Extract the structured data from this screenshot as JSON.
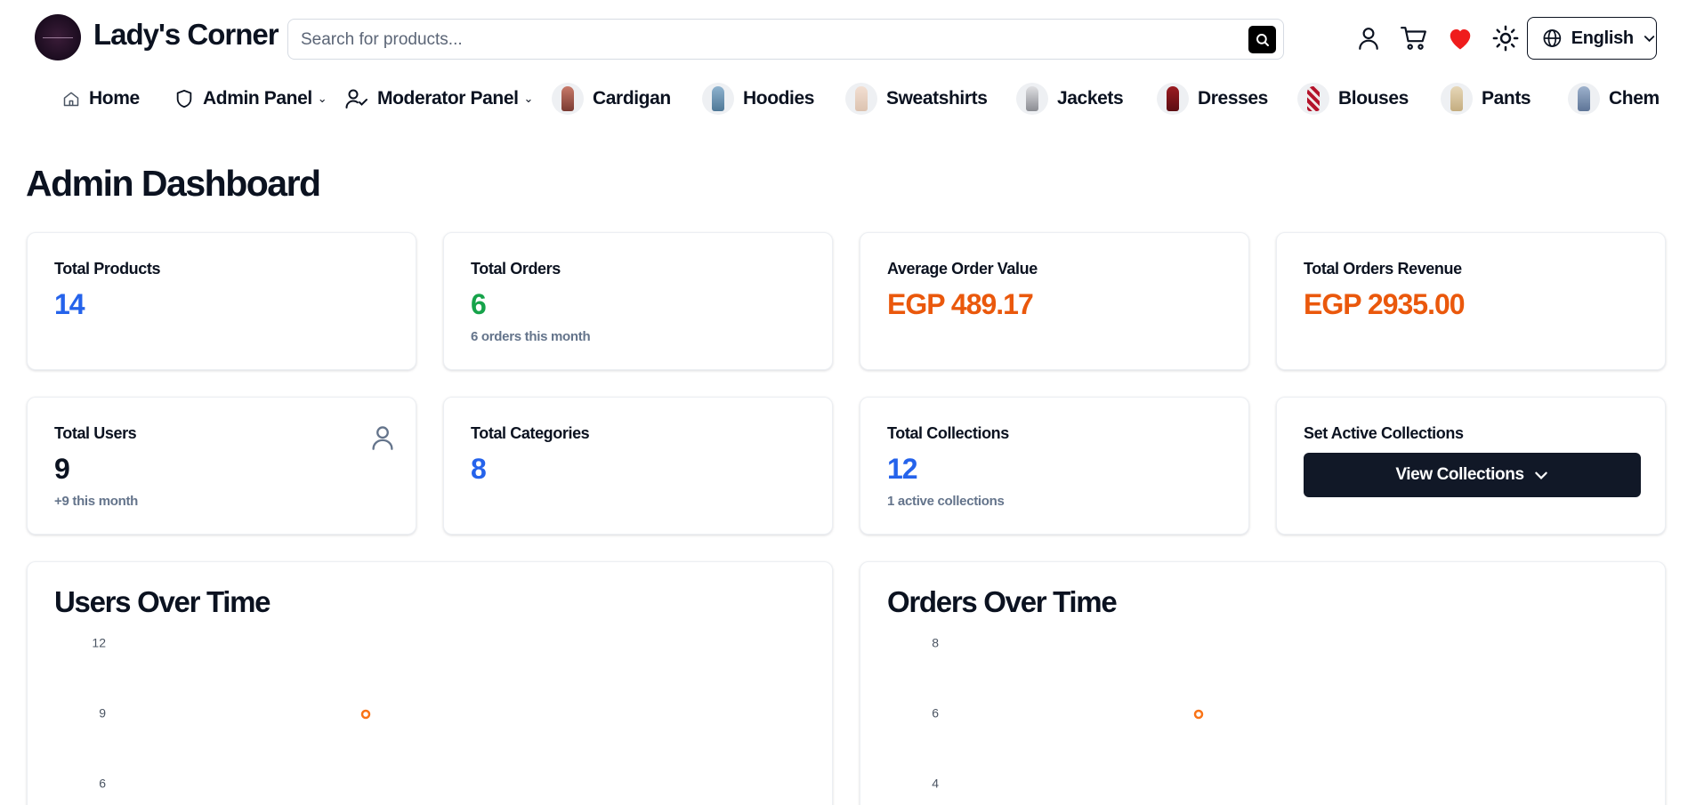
{
  "header": {
    "brand": "Lady's Corner",
    "search_placeholder": "Search for products...",
    "language": "English"
  },
  "nav": {
    "items": [
      {
        "label": "Home",
        "icon": "home-icon"
      },
      {
        "label": "Admin Panel",
        "icon": "shield-icon"
      },
      {
        "label": "Moderator Panel",
        "icon": "user-check-icon"
      },
      {
        "label": "Cardigan"
      },
      {
        "label": "Hoodies"
      },
      {
        "label": "Sweatshirts"
      },
      {
        "label": "Jackets"
      },
      {
        "label": "Dresses"
      },
      {
        "label": "Blouses"
      },
      {
        "label": "Pants"
      },
      {
        "label": "Chemis"
      }
    ]
  },
  "page": {
    "title": "Admin Dashboard"
  },
  "stats": {
    "total_products": {
      "label": "Total Products",
      "value": "14"
    },
    "total_orders": {
      "label": "Total Orders",
      "value": "6",
      "sub": "6 orders this month"
    },
    "avg_order_value": {
      "label": "Average Order Value",
      "value": "EGP 489.17"
    },
    "total_revenue": {
      "label": "Total Orders Revenue",
      "value": "EGP 2935.00"
    },
    "total_users": {
      "label": "Total Users",
      "value": "9",
      "sub": "+9 this month"
    },
    "total_categories": {
      "label": "Total Categories",
      "value": "8"
    },
    "total_collections": {
      "label": "Total Collections",
      "value": "12",
      "sub": "1 active collections"
    },
    "active_collections": {
      "label": "Set Active Collections",
      "button": "View Collections"
    }
  },
  "colors": {
    "accent_blue": "#2563eb",
    "accent_green": "#16a34a",
    "accent_orange": "#ea580c",
    "point_orange": "#f97316",
    "button_dark": "#111827",
    "favorite_red": "#ef1c1c"
  },
  "chart_data": [
    {
      "type": "line",
      "title": "Users Over Time",
      "y_ticks": [
        12,
        9,
        6
      ],
      "series": [
        {
          "values": [
            9
          ]
        }
      ]
    },
    {
      "type": "line",
      "title": "Orders Over Time",
      "y_ticks": [
        8,
        6,
        4
      ],
      "series": [
        {
          "values": [
            6
          ]
        }
      ]
    }
  ]
}
